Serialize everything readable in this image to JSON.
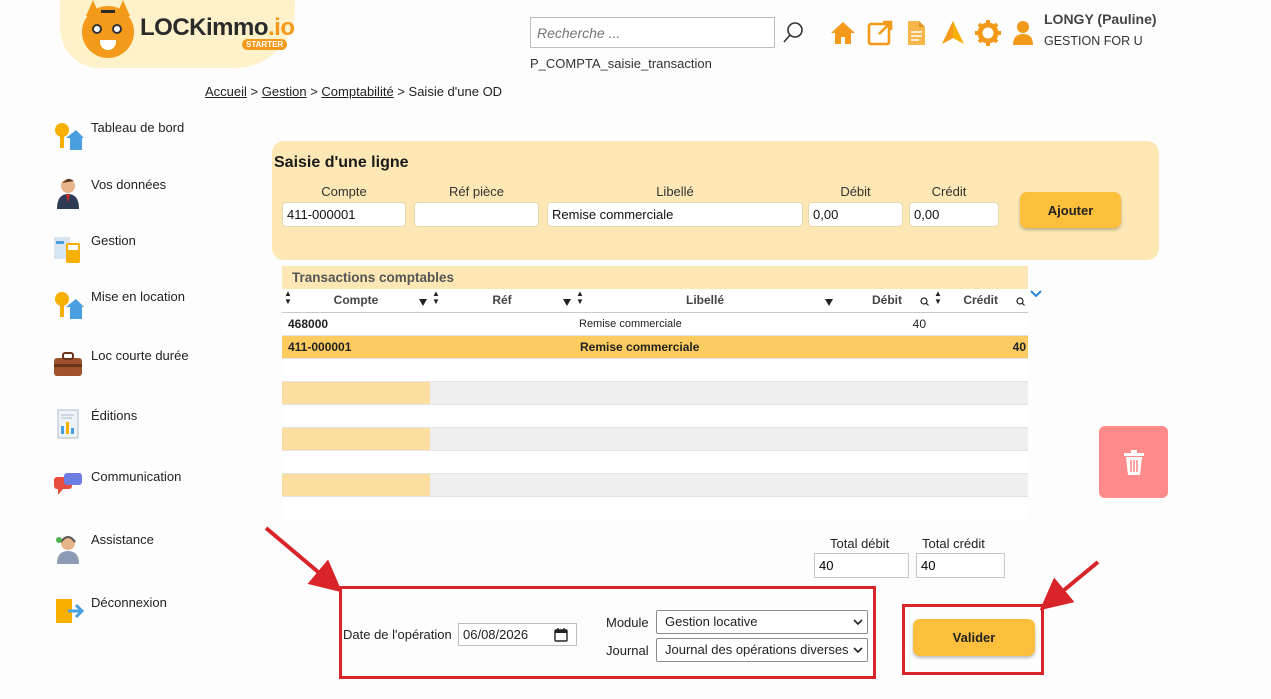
{
  "header": {
    "logo_text": "LOCKimmo",
    "logo_suffix": ".io",
    "logo_badge": "STARTER",
    "search_placeholder": "Recherche ...",
    "page_code": "P_COMPTA_saisie_transaction",
    "user_name": "LONGY (Pauline)",
    "user_org": "GESTION FOR U",
    "icons": [
      "search-icon",
      "home-icon",
      "external-link-icon",
      "document-icon",
      "navigation-icon",
      "gear-icon",
      "user-icon"
    ],
    "accent_color": "#f49a1a"
  },
  "breadcrumb": {
    "items": [
      "Accueil",
      "Gestion",
      "Comptabilité"
    ],
    "current": "Saisie d'une OD",
    "separator": ">"
  },
  "sidebar": {
    "items": [
      {
        "label": "Tableau de bord",
        "icon": "house-key-icon"
      },
      {
        "label": "Vos données",
        "icon": "person-icon"
      },
      {
        "label": "Gestion",
        "icon": "calculator-icon"
      },
      {
        "label": "Mise en location",
        "icon": "house-key-icon"
      },
      {
        "label": "Loc courte durée",
        "icon": "suitcase-icon"
      },
      {
        "label": "Éditions",
        "icon": "report-icon"
      },
      {
        "label": "Communication",
        "icon": "chat-icon"
      },
      {
        "label": "Assistance",
        "icon": "support-agent-icon"
      },
      {
        "label": "Déconnexion",
        "icon": "logout-icon"
      }
    ]
  },
  "saisie": {
    "title": "Saisie d'une ligne",
    "labels": {
      "compte": "Compte",
      "ref": "Réf pièce",
      "libelle": "Libellé",
      "debit": "Débit",
      "credit": "Crédit"
    },
    "values": {
      "compte": "411-000001",
      "ref": "",
      "libelle": "Remise commerciale",
      "debit": "0,00",
      "credit": "0,00"
    },
    "add_button": "Ajouter"
  },
  "grid": {
    "title": "Transactions comptables",
    "columns": [
      "Compte",
      "Réf",
      "Libellé",
      "Débit",
      "Crédit"
    ],
    "rows": [
      {
        "compte": "468000",
        "ref": "",
        "libelle": "Remise commerciale",
        "debit": "40",
        "credit": ""
      },
      {
        "compte": "411-000001",
        "ref": "",
        "libelle": "Remise commerciale",
        "debit": "",
        "credit": "40"
      }
    ],
    "empty_rows": 7
  },
  "totals": {
    "debit_label": "Total débit",
    "credit_label": "Total crédit",
    "debit_value": "40",
    "credit_value": "40"
  },
  "operation": {
    "date_label": "Date de l'opération",
    "date_value": "06/08/2026",
    "module_label": "Module",
    "module_value": "Gestion locative",
    "journal_label": "Journal",
    "journal_value": "Journal des opérations diverses"
  },
  "actions": {
    "validate": "Valider",
    "delete_icon": "trash-icon"
  },
  "colors": {
    "panel": "#fde8b5",
    "button": "#fcbf3c",
    "selected_row": "#fdcb5f",
    "delete": "#ff8a8a",
    "annotation": "#d9252a"
  }
}
